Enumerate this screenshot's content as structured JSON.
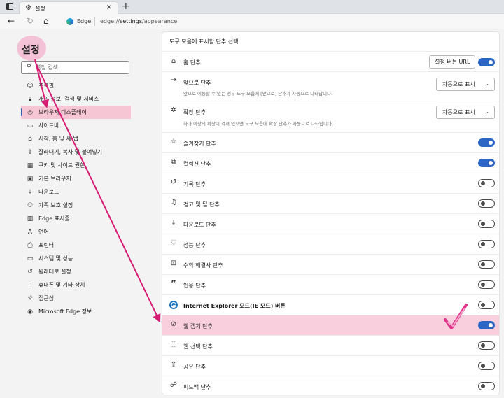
{
  "browser": {
    "tab_title": "설정",
    "edge_label": "Edge",
    "url_prefix": "edge://",
    "url_bold": "settings",
    "url_suffix": "/appearance"
  },
  "sidebar": {
    "title": "설정",
    "search_placeholder": "설정 검색",
    "items": [
      {
        "label": "프로필",
        "icon": "profile-icon"
      },
      {
        "label": "개인 정보, 검색 및 서비스",
        "icon": "lock-icon"
      },
      {
        "label": "브라우저 디스플레이",
        "icon": "palette-icon",
        "active": true
      },
      {
        "label": "사이드바",
        "icon": "sidebar-icon"
      },
      {
        "label": "시작, 홈 및 새 탭",
        "icon": "home-icon"
      },
      {
        "label": "잘라내기, 복사 및 붙여넣기",
        "icon": "share-icon"
      },
      {
        "label": "쿠키 및 사이트 권한",
        "icon": "cookie-icon"
      },
      {
        "label": "기본 브라우저",
        "icon": "browser-icon"
      },
      {
        "label": "다운로드",
        "icon": "download-icon"
      },
      {
        "label": "가족 보호 설정",
        "icon": "family-icon"
      },
      {
        "label": "Edge 표시줄",
        "icon": "edge-bar-icon"
      },
      {
        "label": "언어",
        "icon": "language-icon"
      },
      {
        "label": "프린터",
        "icon": "printer-icon"
      },
      {
        "label": "시스템 및 성능",
        "icon": "system-icon"
      },
      {
        "label": "원래대로 설정",
        "icon": "reset-icon"
      },
      {
        "label": "휴대폰 및 기타 장치",
        "icon": "phone-icon"
      },
      {
        "label": "접근성",
        "icon": "accessibility-icon"
      },
      {
        "label": "Microsoft Edge 정보",
        "icon": "edge-logo-icon"
      }
    ]
  },
  "main": {
    "header": "도구 모음에 표시할 단추 선택:",
    "home_button_label": "설정 버튼 URL",
    "rows": [
      {
        "label": "홈 단추",
        "icon": "home-icon",
        "control": "toggle",
        "on": true
      },
      {
        "label": "앞으로 단추",
        "icon": "forward-arrow-icon",
        "desc": "앞으로 이동할 수 있는 경우 도구 모음에 [앞으로] 단추가 자동으로 나타납니다.",
        "control": "select",
        "value": "자동으로 표시"
      },
      {
        "label": "확장 단추",
        "icon": "extension-icon",
        "desc": "하나 이상의 확장이 켜져 있으면 도구 모음에 확장 단추가 자동으로 나타납니다.",
        "control": "select",
        "value": "자동으로 표시"
      },
      {
        "label": "즐겨찾기 단추",
        "icon": "star-icon",
        "control": "toggle",
        "on": true
      },
      {
        "label": "컬렉션 단추",
        "icon": "collections-icon",
        "control": "toggle",
        "on": true
      },
      {
        "label": "기록 단추",
        "icon": "history-icon",
        "control": "toggle",
        "on": false
      },
      {
        "label": "경고 및 팁 단추",
        "icon": "bell-icon",
        "control": "toggle",
        "on": false
      },
      {
        "label": "다운로드 단추",
        "icon": "download-icon",
        "control": "toggle",
        "on": false
      },
      {
        "label": "성능 단추",
        "icon": "heartbeat-icon",
        "control": "toggle",
        "on": false
      },
      {
        "label": "수학 해결사 단추",
        "icon": "math-icon",
        "control": "toggle",
        "on": false
      },
      {
        "label": "인용 단추",
        "icon": "quote-icon",
        "control": "toggle",
        "on": false
      },
      {
        "label": "Internet Explorer 모드(IE 모드) 버튼",
        "icon": "ie-icon",
        "control": "toggle",
        "on": false,
        "bold": true
      },
      {
        "label": "웹 캡처 단추",
        "icon": "web-capture-icon",
        "control": "toggle",
        "on": true,
        "highlight": true
      },
      {
        "label": "웹 선택 단추",
        "icon": "web-select-icon",
        "control": "toggle",
        "on": false
      },
      {
        "label": "공유 단추",
        "icon": "share-icon",
        "control": "toggle",
        "on": false
      },
      {
        "label": "피드백 단추",
        "icon": "feedback-icon",
        "control": "toggle",
        "on": false
      }
    ]
  },
  "colors": {
    "accent": "#2b66c4",
    "highlight": "#f9cfdd",
    "annotation": "#d81b72"
  }
}
